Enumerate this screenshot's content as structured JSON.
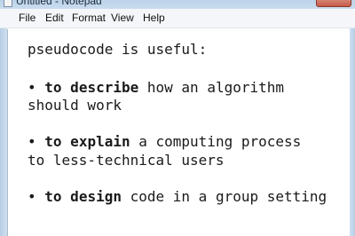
{
  "window": {
    "title": "Untitled - Notepad"
  },
  "menu": {
    "file": "File",
    "edit": "Edit",
    "format": "Format",
    "view": "View",
    "help": "Help"
  },
  "document": {
    "line1": "pseudocode is useful:",
    "bullet1": {
      "marker": "•",
      "bold": "to describe",
      "rest": " how an algorithm"
    },
    "bullet1_cont": "should work",
    "bullet2": {
      "marker": "•",
      "bold": "to explain",
      "rest": " a computing process"
    },
    "bullet2_cont": "to less-technical users",
    "bullet3": {
      "marker": "•",
      "bold": "to design",
      "rest": " code in a group setting"
    }
  }
}
